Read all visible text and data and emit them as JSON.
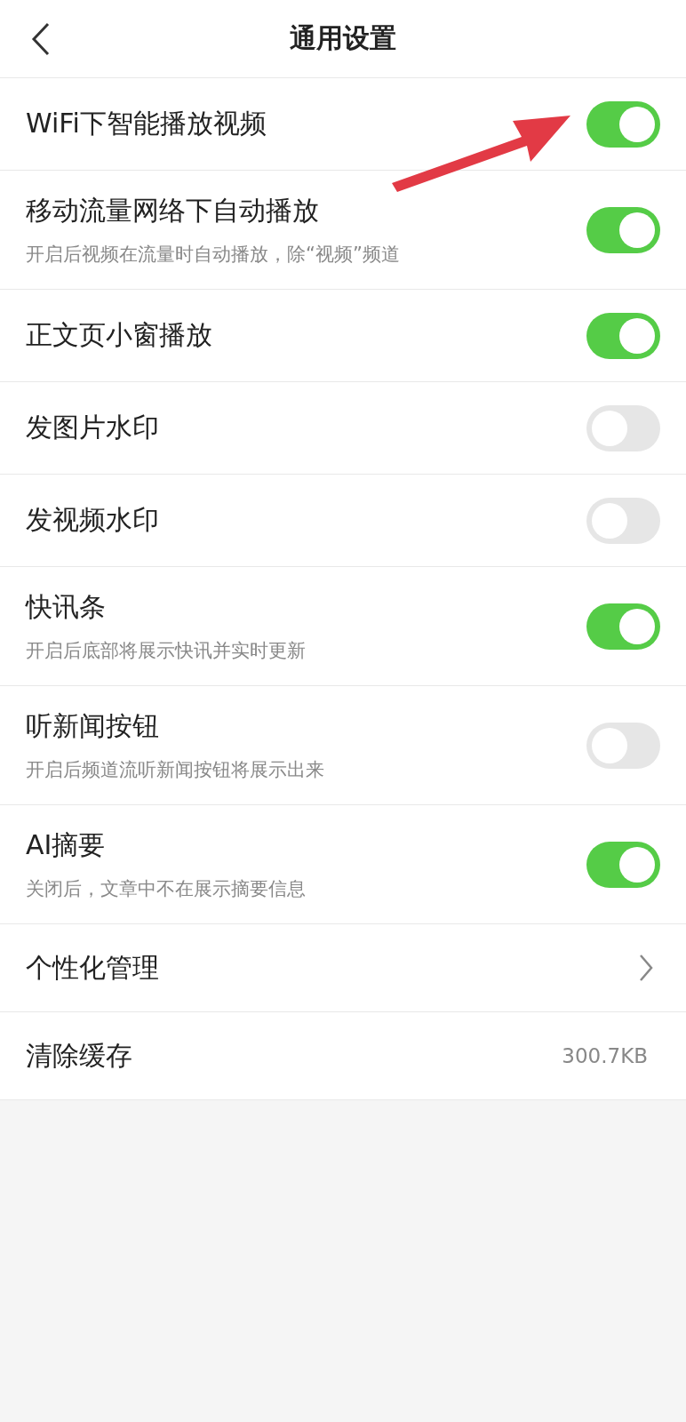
{
  "header": {
    "title": "通用设置"
  },
  "items": [
    {
      "kind": "toggle",
      "label": "WiFi下智能播放视频",
      "on": true
    },
    {
      "kind": "toggle",
      "label": "移动流量网络下自动播放",
      "description": "开启后视频在流量时自动播放，除“视频”频道",
      "on": true
    },
    {
      "kind": "toggle",
      "label": "正文页小窗播放",
      "on": true
    },
    {
      "kind": "toggle",
      "label": "发图片水印",
      "on": false
    },
    {
      "kind": "toggle",
      "label": "发视频水印",
      "on": false
    },
    {
      "kind": "toggle",
      "label": "快讯条",
      "description": "开启后底部将展示快讯并实时更新",
      "on": true
    },
    {
      "kind": "toggle",
      "label": "听新闻按钮",
      "description": "开启后频道流听新闻按钮将展示出来",
      "on": false
    },
    {
      "kind": "toggle",
      "label": "AI摘要",
      "description": "关闭后，文章中不在展示摘要信息",
      "on": true
    },
    {
      "kind": "link",
      "label": "个性化管理"
    },
    {
      "kind": "value",
      "label": "清除缓存",
      "value": "300.7KB"
    }
  ]
}
